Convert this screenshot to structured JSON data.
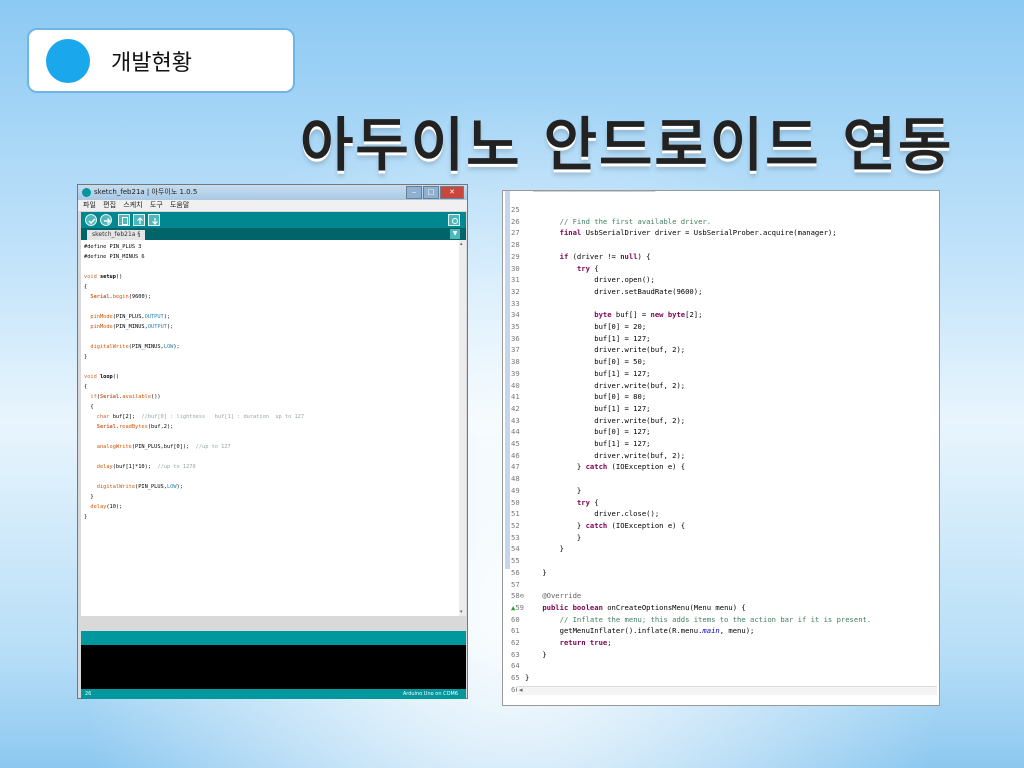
{
  "slide": {
    "badge_label": "개발현황",
    "title": "아두이노 안드로이드 연동"
  },
  "ide": {
    "window_title": "sketch_feb21a | 아두이노 1.0.5",
    "window_buttons": {
      "min": "‒",
      "max": "□",
      "close": "✕"
    },
    "menu": [
      "파일",
      "편집",
      "스케치",
      "도구",
      "도움말"
    ],
    "toolbar_icons": [
      "verify-icon",
      "upload-icon",
      "new-icon",
      "open-icon",
      "save-icon",
      "serial-monitor-icon"
    ],
    "tab": "sketch_feb21a §",
    "tab_menu": "▼",
    "status_line": "26",
    "status_board": "Arduino Uno on COM6",
    "colors": {
      "teal": "#00979d",
      "dark_teal": "#006468",
      "console": "#000000"
    }
  },
  "java": {
    "gutter_markers": {
      "58": "⊖",
      "59": "▲"
    },
    "lines": [
      {
        "n": "25",
        "t": ""
      },
      {
        "n": "26",
        "t": "        // Find the first available driver."
      },
      {
        "n": "27",
        "t": "        final UsbSerialDriver driver = UsbSerialProber.acquire(manager);"
      },
      {
        "n": "28",
        "t": ""
      },
      {
        "n": "29",
        "t": "        if (driver != null) {"
      },
      {
        "n": "30",
        "t": "            try {"
      },
      {
        "n": "31",
        "t": "                driver.open();"
      },
      {
        "n": "32",
        "t": "                driver.setBaudRate(9600);"
      },
      {
        "n": "33",
        "t": ""
      },
      {
        "n": "34",
        "t": "                byte buf[] = new byte[2];"
      },
      {
        "n": "35",
        "t": "                buf[0] = 20;"
      },
      {
        "n": "36",
        "t": "                buf[1] = 127;"
      },
      {
        "n": "37",
        "t": "                driver.write(buf, 2);"
      },
      {
        "n": "38",
        "t": "                buf[0] = 50;"
      },
      {
        "n": "39",
        "t": "                buf[1] = 127;"
      },
      {
        "n": "40",
        "t": "                driver.write(buf, 2);"
      },
      {
        "n": "41",
        "t": "                buf[0] = 80;"
      },
      {
        "n": "42",
        "t": "                buf[1] = 127;"
      },
      {
        "n": "43",
        "t": "                driver.write(buf, 2);"
      },
      {
        "n": "44",
        "t": "                buf[0] = 127;"
      },
      {
        "n": "45",
        "t": "                buf[1] = 127;"
      },
      {
        "n": "46",
        "t": "                driver.write(buf, 2);"
      },
      {
        "n": "47",
        "t": "            } catch (IOException e) {"
      },
      {
        "n": "48",
        "t": ""
      },
      {
        "n": "49",
        "t": "            }"
      },
      {
        "n": "50",
        "t": "            try {"
      },
      {
        "n": "51",
        "t": "                driver.close();"
      },
      {
        "n": "52",
        "t": "            } catch (IOException e) {"
      },
      {
        "n": "53",
        "t": "            }"
      },
      {
        "n": "54",
        "t": "        }"
      },
      {
        "n": "55",
        "t": ""
      },
      {
        "n": "56",
        "t": "    }"
      },
      {
        "n": "57",
        "t": ""
      },
      {
        "n": "58",
        "t": "    @Override"
      },
      {
        "n": "59",
        "t": "    public boolean onCreateOptionsMenu(Menu menu) {"
      },
      {
        "n": "60",
        "t": "        // Inflate the menu; this adds items to the action bar if it is present."
      },
      {
        "n": "61",
        "t": "        getMenuInflater().inflate(R.menu.main, menu);"
      },
      {
        "n": "62",
        "t": "        return true;"
      },
      {
        "n": "63",
        "t": "    }"
      },
      {
        "n": "64",
        "t": ""
      },
      {
        "n": "65",
        "t": "}"
      },
      {
        "n": "66",
        "t": ""
      }
    ],
    "hscroll_arrow": "◂"
  }
}
